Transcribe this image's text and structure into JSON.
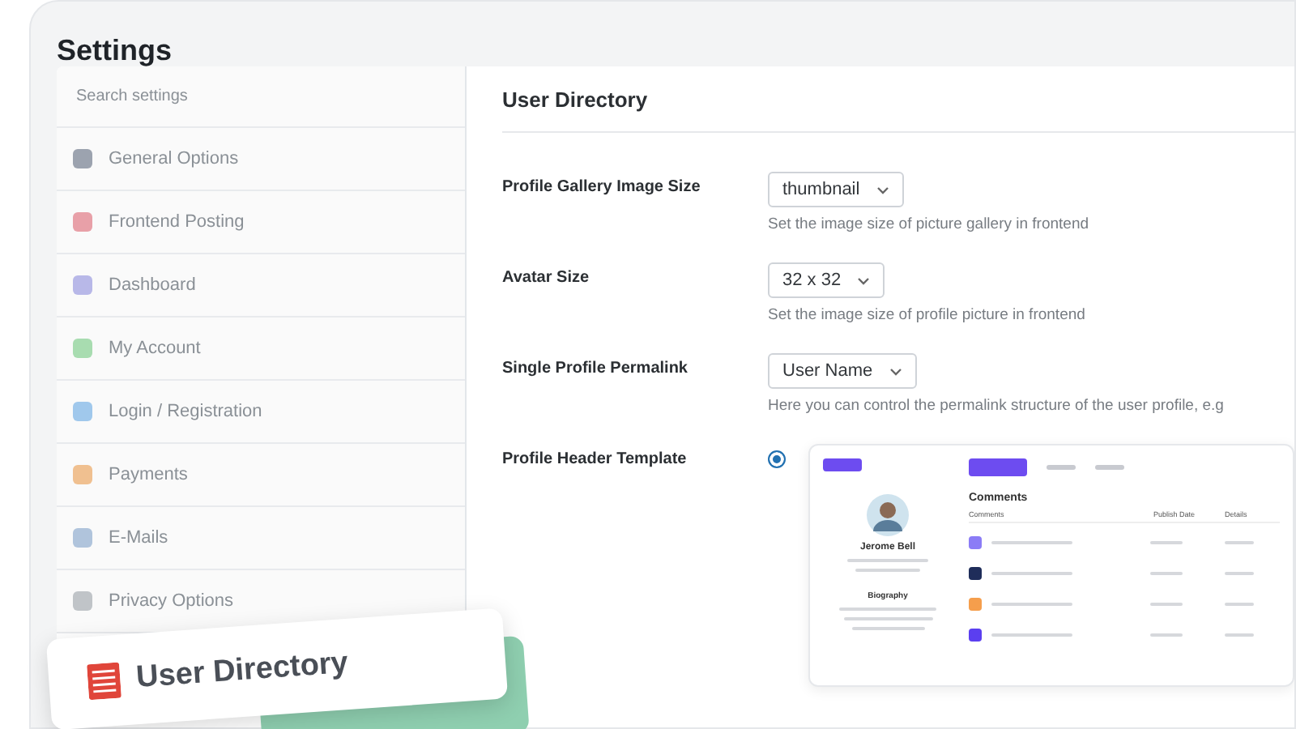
{
  "title": "Settings",
  "sidebar": {
    "search": {
      "placeholder": "Search settings"
    },
    "items": [
      {
        "label": "General Options",
        "color": "#9ca3af"
      },
      {
        "label": "Frontend Posting",
        "color": "#e8a0a8"
      },
      {
        "label": "Dashboard",
        "color": "#b8b8e8"
      },
      {
        "label": "My Account",
        "color": "#a8dcb0"
      },
      {
        "label": "Login / Registration",
        "color": "#a0c8ec"
      },
      {
        "label": "Payments",
        "color": "#f0c090"
      },
      {
        "label": "E-Mails",
        "color": "#b0c4dc"
      },
      {
        "label": "Privacy Options",
        "color": "#c0c4c8"
      }
    ]
  },
  "section": {
    "title": "User Directory",
    "fields": [
      {
        "label": "Profile Gallery Image Size",
        "kind": "select",
        "value": "thumbnail",
        "help": "Set the image size of picture gallery in frontend"
      },
      {
        "label": "Avatar Size",
        "kind": "select",
        "value": "32 x 32",
        "help": "Set the image size of profile picture in frontend"
      },
      {
        "label": "Single Profile Permalink",
        "kind": "select",
        "value": "User Name",
        "help": "Here you can control the permalink structure of the user profile, e.g"
      },
      {
        "label": "Profile Header Template",
        "kind": "template",
        "selected": true,
        "preview": {
          "name": "Jerome Bell",
          "heading": "Comments",
          "columns": [
            "Comments",
            "Publish Date",
            "Details"
          ],
          "bio_title": "Biography"
        }
      }
    ]
  },
  "badge": {
    "label": "User Directory"
  }
}
